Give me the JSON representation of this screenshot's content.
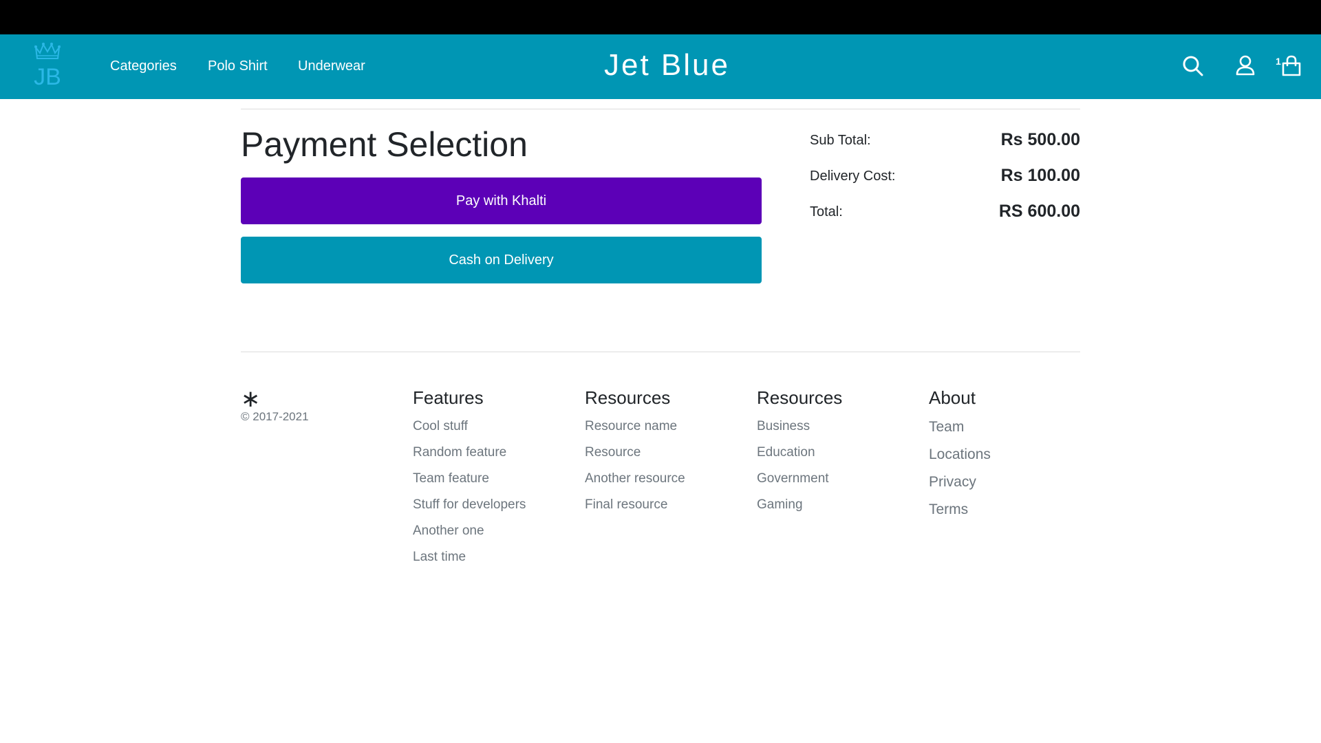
{
  "nav": {
    "logo_text": "JB",
    "links": [
      "Categories",
      "Polo Shirt",
      "Underwear"
    ],
    "brand": "Jet Blue",
    "cart_count": "1",
    "icons": [
      "search-icon",
      "user-icon",
      "shopping-bag-icon"
    ]
  },
  "payment": {
    "title": "Payment Selection",
    "khalti_label": "Pay with Khalti",
    "cod_label": "Cash on Delivery"
  },
  "summary": {
    "subtotal_label": "Sub Total:",
    "subtotal_value": "Rs 500.00",
    "delivery_label": "Delivery Cost:",
    "delivery_value": "Rs 100.00",
    "total_label": "Total:",
    "total_value": "RS 600.00"
  },
  "footer": {
    "mark": "∗",
    "copyright": "© 2017-2021",
    "columns": [
      {
        "title": "Features",
        "items": [
          "Cool stuff",
          "Random feature",
          "Team feature",
          "Stuff for developers",
          "Another one",
          "Last time"
        ]
      },
      {
        "title": "Resources",
        "items": [
          "Resource name",
          "Resource",
          "Another resource",
          "Final resource"
        ]
      },
      {
        "title": "Resources",
        "items": [
          "Business",
          "Education",
          "Government",
          "Gaming"
        ]
      },
      {
        "title": "About",
        "items": [
          "Team",
          "Locations",
          "Privacy",
          "Terms"
        ]
      }
    ]
  },
  "colors": {
    "navbar": "#0096b4",
    "khalti": "#5c00b7",
    "cod": "#0096b4",
    "logo": "#2bb8e6"
  }
}
